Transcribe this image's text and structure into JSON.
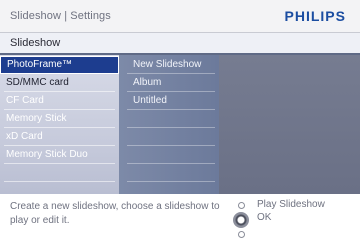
{
  "header": {
    "breadcrumb": "Slideshow | Settings",
    "brand": "PHILIPS",
    "brand_color": "#1b4da1"
  },
  "section": {
    "title": "Slideshow"
  },
  "sources": [
    {
      "label": "PhotoFrame™",
      "state": "selected"
    },
    {
      "label": "SD/MMC card",
      "state": "normal"
    },
    {
      "label": "CF Card",
      "state": "dim"
    },
    {
      "label": "Memory Stick",
      "state": "dim"
    },
    {
      "label": "xD Card",
      "state": "dim"
    },
    {
      "label": "Memory Stick Duo",
      "state": "dim"
    }
  ],
  "slideshows": [
    {
      "label": "New Slideshow"
    },
    {
      "label": "Album"
    },
    {
      "label": "Untitled"
    }
  ],
  "footer": {
    "help_text": "Create a new slideshow, choose a slideshow to play or edit it.",
    "up_action": "Play Slideshow",
    "ok_action": "OK"
  },
  "colors": {
    "selected_bg": "#1d3d8f",
    "mid_panel": "#6c7a9b",
    "right_panel": "#6a7086"
  }
}
